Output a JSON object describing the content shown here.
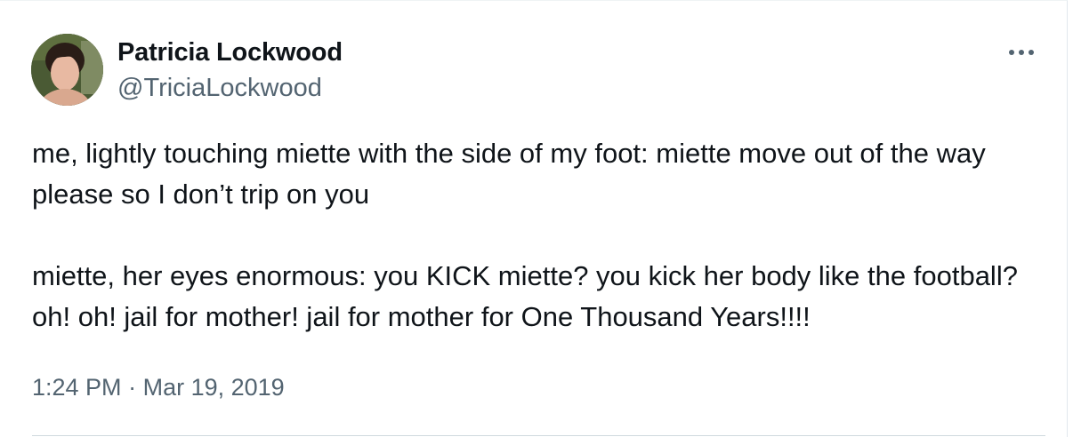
{
  "tweet": {
    "author": {
      "display_name": "Patricia Lockwood",
      "handle": "@TriciaLockwood",
      "avatar_icon": "profile-photo"
    },
    "more_icon": "more-horizontal-icon",
    "text": "me, lightly touching miette with the side of my foot: miette move out of the way please so I don’t trip on you\n\nmiette, her eyes enormous: you KICK miette? you kick her body like the football? oh! oh! jail for mother! jail for mother for One Thousand Years!!!!",
    "time": "1:24 PM",
    "separator": "·",
    "date": "Mar 19, 2019"
  },
  "colors": {
    "text_primary": "#0f1419",
    "text_secondary": "#536471",
    "divider": "#cfd9de"
  }
}
